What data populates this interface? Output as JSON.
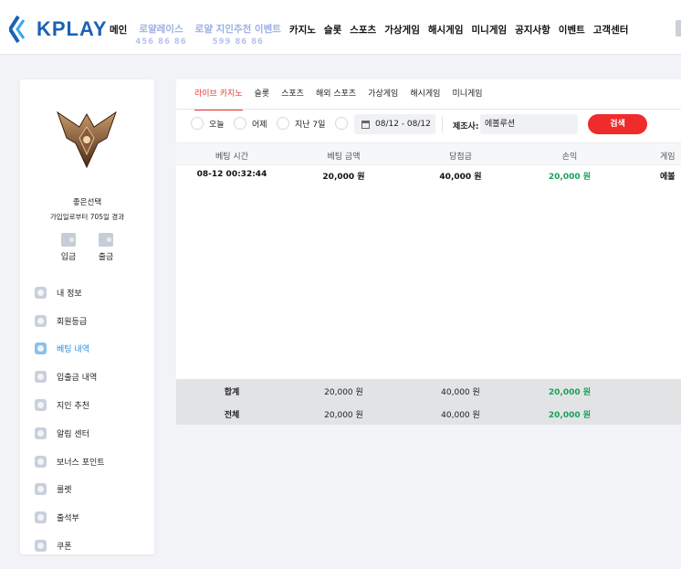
{
  "header": {
    "logo_text": "KPLAY",
    "nav": [
      {
        "label": "메인"
      },
      {
        "label": "로얄레이스",
        "number": "456 86 86",
        "promo": true
      },
      {
        "label": "로얄 지인추천 이벤트",
        "number": "599 86 86",
        "promo": true
      },
      {
        "label": "카지노"
      },
      {
        "label": "슬롯"
      },
      {
        "label": "스포츠"
      },
      {
        "label": "가상게임"
      },
      {
        "label": "해시게임"
      },
      {
        "label": "미니게임"
      },
      {
        "label": "공지사항"
      },
      {
        "label": "이벤트"
      },
      {
        "label": "고객센터"
      }
    ]
  },
  "profile": {
    "name": "좋은선택",
    "member_since": "가입일로부터 705일 경과",
    "deposit_label": "입금",
    "withdraw_label": "출금"
  },
  "sidebar": {
    "items": [
      {
        "label": "내 정보",
        "icon": "user-icon"
      },
      {
        "label": "회원등급",
        "icon": "grade-icon"
      },
      {
        "label": "베팅 내역",
        "icon": "bet-history-icon",
        "active": true
      },
      {
        "label": "입출금 내역",
        "icon": "wallet-icon"
      },
      {
        "label": "지인 추천",
        "icon": "heart-icon"
      },
      {
        "label": "알림 센터",
        "icon": "message-icon"
      },
      {
        "label": "보너스 포인트",
        "icon": "bonus-icon"
      },
      {
        "label": "룰렛",
        "icon": "roulette-icon"
      },
      {
        "label": "출석부",
        "icon": "attendance-icon"
      },
      {
        "label": "쿠폰",
        "icon": "coupon-icon"
      }
    ]
  },
  "tabs": [
    {
      "label": "라이브 카지노",
      "active": true
    },
    {
      "label": "슬롯"
    },
    {
      "label": "스포츠"
    },
    {
      "label": "해외 스포츠"
    },
    {
      "label": "가상게임"
    },
    {
      "label": "해시게임"
    },
    {
      "label": "미니게임"
    }
  ],
  "filter": {
    "today": "오늘",
    "yesterday": "어제",
    "last7": "지난 7일",
    "date_range": "08/12 - 08/12",
    "maker_label": "제조사:",
    "maker_value": "에볼루션",
    "search_label": "검색"
  },
  "table": {
    "headers": [
      "베팅 시간",
      "베팅 금액",
      "당첨금",
      "손익",
      "게임"
    ],
    "rows": [
      {
        "time": "08-12 00:32:44",
        "bet": "20,000 원",
        "win": "40,000 원",
        "profit": "20,000 원",
        "game": "에볼"
      }
    ],
    "summary": [
      {
        "label": "합계",
        "bet": "20,000 원",
        "win": "40,000 원",
        "profit": "20,000 원"
      },
      {
        "label": "전체",
        "bet": "20,000 원",
        "win": "40,000 원",
        "profit": "20,000 원"
      }
    ]
  },
  "colors": {
    "accent": "#e33a35",
    "profit": "#19a15a",
    "active_menu": "#2b8ed6",
    "logo": "#1b62b3"
  }
}
